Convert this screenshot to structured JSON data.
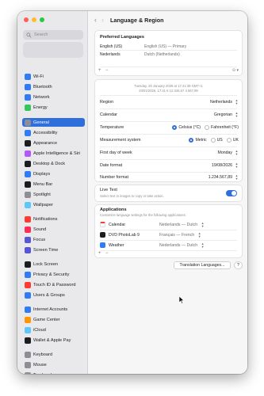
{
  "window": {
    "title": "Language & Region"
  },
  "sidebar": {
    "search_placeholder": "Search",
    "items": [
      {
        "label": "Wi-Fi",
        "icon": "wifi-icon",
        "color": "#2f7cf6"
      },
      {
        "label": "Bluetooth",
        "icon": "bluetooth-icon",
        "color": "#2f7cf6"
      },
      {
        "label": "Network",
        "icon": "network-icon",
        "color": "#2f7cf6"
      },
      {
        "label": "Energy",
        "icon": "energy-icon",
        "color": "#34c759"
      },
      {
        "label": "General",
        "icon": "gear-icon",
        "color": "#8e8e93",
        "selected": true
      },
      {
        "label": "Accessibility",
        "icon": "accessibility-icon",
        "color": "#2f7cf6"
      },
      {
        "label": "Appearance",
        "icon": "appearance-icon",
        "color": "#1d1d1f"
      },
      {
        "label": "Apple Intelligence & Siri",
        "icon": "siri-icon",
        "color": "#b457f5"
      },
      {
        "label": "Desktop & Dock",
        "icon": "dock-icon",
        "color": "#1d1d1f"
      },
      {
        "label": "Displays",
        "icon": "display-icon",
        "color": "#2f7cf6"
      },
      {
        "label": "Menu Bar",
        "icon": "menubar-icon",
        "color": "#1d1d1f"
      },
      {
        "label": "Spotlight",
        "icon": "spotlight-icon",
        "color": "#8e8e93"
      },
      {
        "label": "Wallpaper",
        "icon": "wallpaper-icon",
        "color": "#5ac8fa"
      },
      {
        "label": "Notifications",
        "icon": "notifications-icon",
        "color": "#ff3b30"
      },
      {
        "label": "Sound",
        "icon": "sound-icon",
        "color": "#ff2d55"
      },
      {
        "label": "Focus",
        "icon": "focus-icon",
        "color": "#5856d6"
      },
      {
        "label": "Screen Time",
        "icon": "screentime-icon",
        "color": "#5856d6"
      },
      {
        "label": "Lock Screen",
        "icon": "lock-icon",
        "color": "#1d1d1f"
      },
      {
        "label": "Privacy & Security",
        "icon": "privacy-icon",
        "color": "#2f7cf6"
      },
      {
        "label": "Touch ID & Password",
        "icon": "touchid-icon",
        "color": "#ff3b30"
      },
      {
        "label": "Users & Groups",
        "icon": "users-icon",
        "color": "#2f7cf6"
      },
      {
        "label": "Internet Accounts",
        "icon": "internet-accounts-icon",
        "color": "#2f7cf6"
      },
      {
        "label": "Game Center",
        "icon": "gamecenter-icon",
        "color": "#ff9500"
      },
      {
        "label": "iCloud",
        "icon": "icloud-icon",
        "color": "#5ac8fa"
      },
      {
        "label": "Wallet & Apple Pay",
        "icon": "wallet-icon",
        "color": "#1d1d1f"
      },
      {
        "label": "Keyboard",
        "icon": "keyboard-icon",
        "color": "#8e8e93"
      },
      {
        "label": "Mouse",
        "icon": "mouse-icon",
        "color": "#8e8e93"
      },
      {
        "label": "Trackpad",
        "icon": "trackpad-icon",
        "color": "#8e8e93"
      }
    ]
  },
  "preferred": {
    "title": "Preferred Languages",
    "languages": [
      {
        "name": "English (US)",
        "detail": "English (US) — Primary"
      },
      {
        "name": "Nederlands",
        "detail": "Dutch (Netherlands)"
      }
    ],
    "add": "+",
    "remove": "−",
    "more": "⊙ ▾"
  },
  "format_preview": {
    "line1": "Tuesday, 20 January 2026 at 17:41:39 GMT+1",
    "line2": "20/01/2026, 17:41     € 12.345,67     4.567,89"
  },
  "settings": [
    {
      "label": "Region",
      "value": "Netherlands"
    },
    {
      "label": "Calendar",
      "value": "Gregorian"
    },
    {
      "label": "Temperature",
      "radio": [
        "Celsius (°C)",
        "Fahrenheit (°F)"
      ],
      "selected": 0
    },
    {
      "label": "Measurement system",
      "radio": [
        "Metric",
        "US",
        "UK"
      ],
      "selected": 0
    },
    {
      "label": "First day of week",
      "value": "Monday"
    },
    {
      "label": "Date format",
      "value": "19/08/2026"
    },
    {
      "label": "Number format",
      "value": "1.234.567,89"
    }
  ],
  "live_text": {
    "label": "Live Text",
    "description": "Select text in images to copy or take action.",
    "enabled": true
  },
  "applications": {
    "title": "Applications",
    "description": "Customize language settings for the following applications:",
    "apps": [
      {
        "name": "Calendar",
        "lang": "Nederlands — Dutch",
        "color": "#ff3b30"
      },
      {
        "name": "DVD PhotoLab 9",
        "lang": "Français — French",
        "color": "#1d1d1f"
      },
      {
        "name": "Weather",
        "lang": "Nederlands — Dutch",
        "color": "#2f7cf6"
      }
    ],
    "add": "+",
    "remove": "−"
  },
  "buttons": {
    "translation": "Translation Languages...",
    "help": "?"
  },
  "accent": "#2f6fdb"
}
